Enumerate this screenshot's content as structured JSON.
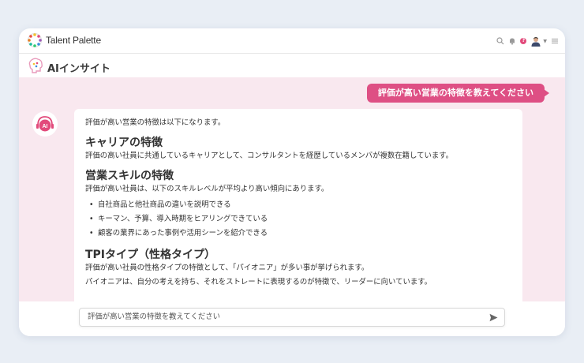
{
  "app": {
    "brand_name": "Talent Palette",
    "section_title": "AIインサイト",
    "notification_count": "?"
  },
  "chat": {
    "user_message": "評価が高い営業の特徴を教えてください",
    "answer": {
      "intro": "評価が高い営業の特徴は以下になります。",
      "sections": [
        {
          "heading": "キャリアの特徴",
          "body": "評価の高い社員に共通しているキャリアとして、コンサルタントを経歴しているメンバが複数在籍しています。"
        },
        {
          "heading": "営業スキルの特徴",
          "body": "評価が高い社員は、以下のスキルレベルが平均より高い傾向にあります。",
          "items": [
            "自社商品と他社商品の違いを説明できる",
            "キーマン、予算、導入時期をヒアリングできている",
            "顧客の業界にあった事例や活用シーンを紹介できる"
          ]
        },
        {
          "heading": "TPIタイプ（性格タイプ）",
          "body": "評価が高い社員の性格タイプの特徴として、「パイオニア」が多い事が挙げられます。",
          "body2": "パイオニアは、自分の考えを持ち、それをストレートに表現するのが特徴で、リーダーに向いています。"
        }
      ]
    }
  },
  "input": {
    "value": "評価が高い営業の特徴を教えてください"
  },
  "icons": {
    "logo": "talent-palette-logo-icon",
    "search": "search-icon",
    "bell": "bell-icon",
    "help": "help-badge-icon",
    "avatar": "user-avatar-icon",
    "menu": "hamburger-menu-icon",
    "ai": "ai-brain-icon",
    "bot": "ai-bot-avatar-icon",
    "send": "send-icon"
  },
  "colors": {
    "accent": "#de4f84",
    "chat_background": "#f9e8ef",
    "page_background": "#e9eef5"
  }
}
